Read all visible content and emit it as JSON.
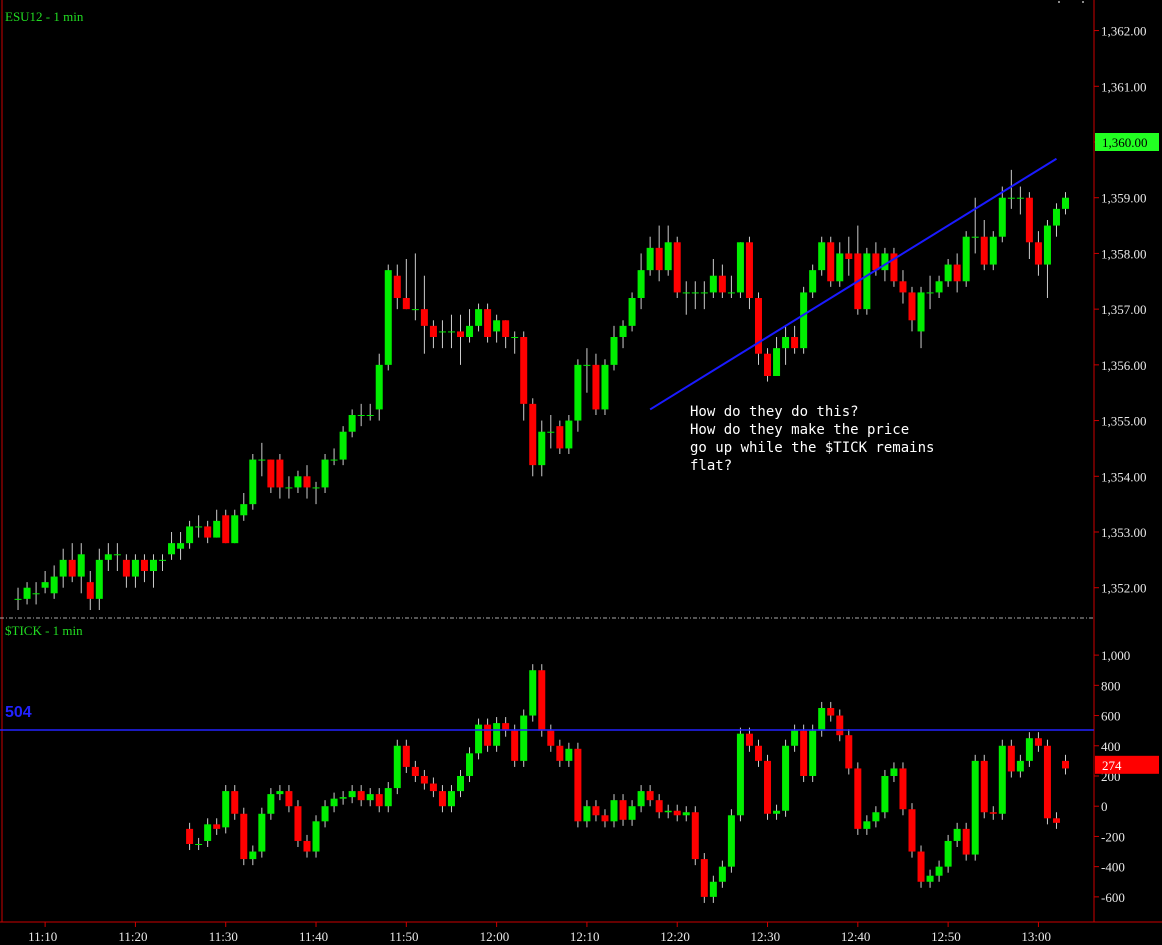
{
  "chart_data": [
    {
      "type": "candlestick",
      "title": "ESU12 - 1 min",
      "ylim": [
        1351.6,
        1362.1
      ],
      "y_ticks": [
        "1,362.00",
        "1,361.00",
        "1,360.00",
        "1,359.00",
        "1,358.00",
        "1,357.00",
        "1,356.00",
        "1,355.00",
        "1,354.00",
        "1,353.00",
        "1,352.00"
      ],
      "y_tick_values": [
        1362,
        1361,
        1360,
        1359,
        1358,
        1357,
        1356,
        1355,
        1354,
        1353,
        1352
      ],
      "last_price_label": "1,360.00",
      "last_price": 1360.0,
      "trendline": {
        "from": {
          "time": "12:17",
          "price": 1355.2
        },
        "to": {
          "time": "13:02",
          "price": 1359.7
        }
      },
      "annotation": [
        "How do they do this?",
        "How do they make the price",
        "go up while the $TICK remains",
        "flat?"
      ]
    },
    {
      "type": "bar",
      "title": "$TICK - 1 min",
      "ylim": [
        -720,
        1100
      ],
      "y_ticks": [
        "1,000",
        "800",
        "600",
        "400",
        "200",
        "0",
        "-200",
        "-400",
        "-600"
      ],
      "y_tick_values": [
        1000,
        800,
        600,
        400,
        200,
        0,
        -200,
        -400,
        -600
      ],
      "reference_line": {
        "value": 504,
        "label": "504"
      },
      "last_value_label": "274",
      "last_value": 274
    }
  ],
  "x_axis": {
    "labels": [
      "11:10",
      "11:20",
      "11:30",
      "11:40",
      "11:50",
      "12:00",
      "12:10",
      "12:20",
      "12:30",
      "12:40",
      "12:50",
      "13:00"
    ],
    "start": "11:06",
    "bars": 118
  },
  "price_candles": [
    [
      1351.8,
      1351.8,
      1352.0,
      1351.6
    ],
    [
      1351.8,
      1352.0,
      1352.1,
      1351.7
    ],
    [
      1351.9,
      1351.9,
      1352.1,
      1351.7
    ],
    [
      1352.0,
      1352.1,
      1352.3,
      1351.9
    ],
    [
      1351.9,
      1352.2,
      1352.4,
      1351.8
    ],
    [
      1352.2,
      1352.5,
      1352.7,
      1352.0
    ],
    [
      1352.5,
      1352.2,
      1352.8,
      1352.1
    ],
    [
      1352.2,
      1352.6,
      1352.8,
      1351.9
    ],
    [
      1352.1,
      1351.8,
      1352.3,
      1351.6
    ],
    [
      1351.8,
      1352.5,
      1352.7,
      1351.6
    ],
    [
      1352.5,
      1352.6,
      1352.8,
      1352.3
    ],
    [
      1352.6,
      1352.6,
      1352.8,
      1352.3
    ],
    [
      1352.5,
      1352.2,
      1352.6,
      1352.0
    ],
    [
      1352.2,
      1352.5,
      1352.6,
      1352.0
    ],
    [
      1352.5,
      1352.3,
      1352.6,
      1352.1
    ],
    [
      1352.3,
      1352.5,
      1352.6,
      1352.0
    ],
    [
      1352.5,
      1352.5,
      1352.6,
      1352.3
    ],
    [
      1352.6,
      1352.8,
      1353.0,
      1352.5
    ],
    [
      1352.7,
      1352.8,
      1353.0,
      1352.5
    ],
    [
      1352.8,
      1353.1,
      1353.2,
      1352.7
    ],
    [
      1353.1,
      1353.1,
      1353.3,
      1352.9
    ],
    [
      1353.1,
      1352.9,
      1353.2,
      1352.8
    ],
    [
      1352.9,
      1353.2,
      1353.4,
      1352.9
    ],
    [
      1353.3,
      1352.8,
      1353.4,
      1352.8
    ],
    [
      1352.8,
      1353.3,
      1353.4,
      1352.8
    ],
    [
      1353.3,
      1353.5,
      1353.7,
      1353.2
    ],
    [
      1353.5,
      1354.3,
      1354.4,
      1353.4
    ],
    [
      1354.3,
      1354.3,
      1354.6,
      1354.0
    ],
    [
      1354.3,
      1353.8,
      1354.3,
      1353.7
    ],
    [
      1354.3,
      1353.8,
      1354.4,
      1353.6
    ],
    [
      1353.8,
      1353.8,
      1354.0,
      1353.6
    ],
    [
      1353.8,
      1354.0,
      1354.1,
      1353.7
    ],
    [
      1354.0,
      1353.8,
      1354.2,
      1353.6
    ],
    [
      1353.8,
      1353.8,
      1353.9,
      1353.5
    ],
    [
      1353.8,
      1354.3,
      1354.4,
      1353.7
    ],
    [
      1354.3,
      1354.3,
      1354.5,
      1354.2
    ],
    [
      1354.3,
      1354.8,
      1354.9,
      1354.2
    ],
    [
      1354.8,
      1355.1,
      1355.2,
      1354.7
    ],
    [
      1355.1,
      1355.1,
      1355.3,
      1354.9
    ],
    [
      1355.1,
      1355.1,
      1355.3,
      1355.0
    ],
    [
      1355.2,
      1356.0,
      1356.2,
      1355.0
    ],
    [
      1356.0,
      1357.7,
      1357.8,
      1355.9
    ],
    [
      1357.6,
      1357.2,
      1357.8,
      1357.0
    ],
    [
      1357.2,
      1357.0,
      1357.9,
      1357.0
    ],
    [
      1357.0,
      1357.0,
      1358.0,
      1356.8
    ],
    [
      1357.0,
      1356.7,
      1357.6,
      1356.2
    ],
    [
      1356.7,
      1356.5,
      1356.8,
      1356.3
    ],
    [
      1356.6,
      1356.6,
      1356.8,
      1356.3
    ],
    [
      1356.6,
      1356.6,
      1356.9,
      1356.3
    ],
    [
      1356.6,
      1356.5,
      1356.9,
      1356.0
    ],
    [
      1356.5,
      1356.7,
      1357.0,
      1356.4
    ],
    [
      1356.7,
      1357.0,
      1357.1,
      1356.6
    ],
    [
      1357.0,
      1356.5,
      1357.1,
      1356.4
    ],
    [
      1356.6,
      1356.8,
      1356.9,
      1356.4
    ],
    [
      1356.8,
      1356.5,
      1356.8,
      1356.3
    ],
    [
      1356.5,
      1356.5,
      1356.6,
      1356.2
    ],
    [
      1356.5,
      1355.3,
      1356.6,
      1355.0
    ],
    [
      1355.3,
      1354.2,
      1355.4,
      1354.0
    ],
    [
      1354.2,
      1354.8,
      1355.0,
      1354.0
    ],
    [
      1354.8,
      1354.8,
      1355.1,
      1354.5
    ],
    [
      1354.9,
      1354.5,
      1355.0,
      1354.4
    ],
    [
      1354.5,
      1355.0,
      1355.1,
      1354.4
    ],
    [
      1355.0,
      1356.0,
      1356.1,
      1354.8
    ],
    [
      1356.0,
      1356.0,
      1356.3,
      1355.5
    ],
    [
      1356.0,
      1355.2,
      1356.2,
      1355.1
    ],
    [
      1355.2,
      1356.0,
      1356.1,
      1355.1
    ],
    [
      1356.0,
      1356.5,
      1356.7,
      1355.9
    ],
    [
      1356.5,
      1356.7,
      1356.8,
      1356.3
    ],
    [
      1356.7,
      1357.2,
      1357.3,
      1356.6
    ],
    [
      1357.2,
      1357.7,
      1358.0,
      1357.0
    ],
    [
      1357.7,
      1358.1,
      1358.3,
      1357.6
    ],
    [
      1358.1,
      1357.7,
      1358.5,
      1357.5
    ],
    [
      1357.7,
      1358.2,
      1358.5,
      1357.6
    ],
    [
      1358.2,
      1357.3,
      1358.3,
      1357.2
    ],
    [
      1357.3,
      1357.3,
      1357.5,
      1356.9
    ],
    [
      1357.3,
      1357.3,
      1357.5,
      1357.0
    ],
    [
      1357.3,
      1357.3,
      1357.5,
      1357.0
    ],
    [
      1357.3,
      1357.6,
      1357.9,
      1357.2
    ],
    [
      1357.6,
      1357.3,
      1357.8,
      1357.2
    ],
    [
      1357.3,
      1357.3,
      1357.6,
      1357.2
    ],
    [
      1357.3,
      1358.2,
      1358.2,
      1357.2
    ],
    [
      1358.2,
      1357.2,
      1358.3,
      1357.0
    ],
    [
      1357.2,
      1356.2,
      1357.3,
      1356.0
    ],
    [
      1356.2,
      1355.8,
      1356.3,
      1355.7
    ],
    [
      1355.8,
      1356.3,
      1356.5,
      1355.8
    ],
    [
      1356.3,
      1356.5,
      1356.7,
      1356.0
    ],
    [
      1356.5,
      1356.3,
      1356.7,
      1356.2
    ],
    [
      1356.3,
      1357.3,
      1357.4,
      1356.2
    ],
    [
      1357.3,
      1357.7,
      1357.8,
      1357.2
    ],
    [
      1357.7,
      1358.2,
      1358.3,
      1357.6
    ],
    [
      1358.2,
      1357.5,
      1358.3,
      1357.4
    ],
    [
      1357.5,
      1358.0,
      1358.2,
      1357.4
    ],
    [
      1358.0,
      1357.9,
      1358.3,
      1357.6
    ],
    [
      1358.0,
      1357.0,
      1358.5,
      1356.9
    ],
    [
      1357.0,
      1358.0,
      1358.1,
      1356.9
    ],
    [
      1358.0,
      1357.7,
      1358.2,
      1357.6
    ],
    [
      1357.7,
      1358.0,
      1358.1,
      1357.5
    ],
    [
      1358.0,
      1357.5,
      1358.1,
      1357.4
    ],
    [
      1357.5,
      1357.3,
      1357.7,
      1357.1
    ],
    [
      1357.3,
      1356.8,
      1357.4,
      1356.6
    ],
    [
      1356.6,
      1357.3,
      1357.4,
      1356.3
    ],
    [
      1357.3,
      1357.3,
      1357.6,
      1357.0
    ],
    [
      1357.3,
      1357.5,
      1357.6,
      1357.2
    ],
    [
      1357.5,
      1357.8,
      1357.9,
      1357.4
    ],
    [
      1357.8,
      1357.5,
      1358.0,
      1357.3
    ],
    [
      1357.5,
      1358.3,
      1358.4,
      1357.4
    ],
    [
      1358.3,
      1358.3,
      1359.0,
      1358.0
    ],
    [
      1358.3,
      1357.8,
      1358.6,
      1357.7
    ],
    [
      1357.8,
      1358.3,
      1358.4,
      1357.7
    ],
    [
      1358.3,
      1359.0,
      1359.2,
      1358.2
    ],
    [
      1359.0,
      1359.0,
      1359.5,
      1358.8
    ],
    [
      1359.0,
      1359.0,
      1359.2,
      1358.7
    ],
    [
      1359.0,
      1358.2,
      1359.1,
      1357.9
    ]
  ],
  "price_candles_tail": [
    [
      1358.2,
      1357.8,
      1358.4,
      1357.6
    ],
    [
      1357.8,
      1358.5,
      1358.6,
      1357.2
    ],
    [
      1358.5,
      1358.8,
      1358.9,
      1358.3
    ],
    [
      1358.8,
      1359.0,
      1359.1,
      1358.7
    ]
  ],
  "tick_bars": [
    [
      -150,
      -250
    ],
    [
      -250,
      -250
    ],
    [
      -230,
      -120
    ],
    [
      -120,
      -150
    ],
    [
      -140,
      100
    ],
    [
      100,
      -50
    ],
    [
      -50,
      -350
    ],
    [
      -350,
      -300
    ],
    [
      -300,
      -50
    ],
    [
      -50,
      80
    ],
    [
      80,
      100
    ],
    [
      100,
      0
    ],
    [
      0,
      -230
    ],
    [
      -230,
      -300
    ],
    [
      -300,
      -100
    ],
    [
      -100,
      0
    ],
    [
      0,
      50
    ],
    [
      50,
      60
    ],
    [
      60,
      100
    ],
    [
      100,
      40
    ],
    [
      40,
      80
    ],
    [
      80,
      0
    ],
    [
      0,
      120
    ],
    [
      120,
      400
    ],
    [
      400,
      260
    ],
    [
      260,
      200
    ],
    [
      200,
      150
    ],
    [
      150,
      100
    ],
    [
      100,
      0
    ],
    [
      0,
      100
    ],
    [
      100,
      200
    ],
    [
      200,
      350
    ],
    [
      350,
      540
    ],
    [
      540,
      400
    ],
    [
      400,
      550
    ],
    [
      550,
      500
    ],
    [
      500,
      300
    ],
    [
      300,
      600
    ],
    [
      600,
      900
    ],
    [
      900,
      500
    ],
    [
      500,
      400
    ],
    [
      400,
      300
    ],
    [
      300,
      380
    ],
    [
      380,
      -100
    ],
    [
      -100,
      0
    ],
    [
      0,
      -60
    ],
    [
      -60,
      -100
    ],
    [
      -100,
      40
    ],
    [
      40,
      -90
    ],
    [
      -90,
      0
    ],
    [
      0,
      100
    ],
    [
      100,
      40
    ],
    [
      40,
      -40
    ],
    [
      -40,
      -30
    ],
    [
      -30,
      -60
    ],
    [
      -60,
      -40
    ],
    [
      -40,
      -350
    ],
    [
      -350,
      -600
    ],
    [
      -600,
      -500
    ],
    [
      -500,
      -400
    ],
    [
      -400,
      -60
    ],
    [
      -60,
      480
    ],
    [
      480,
      400
    ],
    [
      400,
      300
    ],
    [
      300,
      -50
    ],
    [
      -50,
      -30
    ],
    [
      -30,
      400
    ],
    [
      400,
      500
    ],
    [
      500,
      200
    ],
    [
      200,
      500
    ],
    [
      500,
      650
    ],
    [
      650,
      600
    ],
    [
      600,
      470
    ],
    [
      470,
      250
    ],
    [
      250,
      -150
    ],
    [
      -150,
      -100
    ],
    [
      -100,
      -40
    ],
    [
      -40,
      200
    ],
    [
      200,
      250
    ],
    [
      250,
      -20
    ],
    [
      -20,
      -300
    ],
    [
      -300,
      -500
    ],
    [
      -500,
      -460
    ],
    [
      -460,
      -400
    ],
    [
      -400,
      -230
    ],
    [
      -230,
      -150
    ],
    [
      -150,
      -320
    ],
    [
      -320,
      300
    ],
    [
      300,
      -40
    ],
    [
      -40,
      -50
    ],
    [
      -50,
      400
    ],
    [
      400,
      230
    ],
    [
      230,
      300
    ],
    [
      300,
      450
    ],
    [
      450,
      400
    ],
    [
      400,
      -80
    ],
    [
      -80,
      -110
    ]
  ],
  "tick_bars_tail": [
    [
      300,
      250
    ]
  ],
  "colors": {
    "background": "#000000",
    "up": "#00ee00",
    "down": "#ff0000",
    "trendline": "#1a1aff",
    "reference_line": "#2222ff",
    "axis_line": "#cc0000",
    "axis_text": "#e8e8e8",
    "title": "#22dd22",
    "last_price_badge": "#22ff22",
    "last_tick_badge": "#ff0000"
  }
}
